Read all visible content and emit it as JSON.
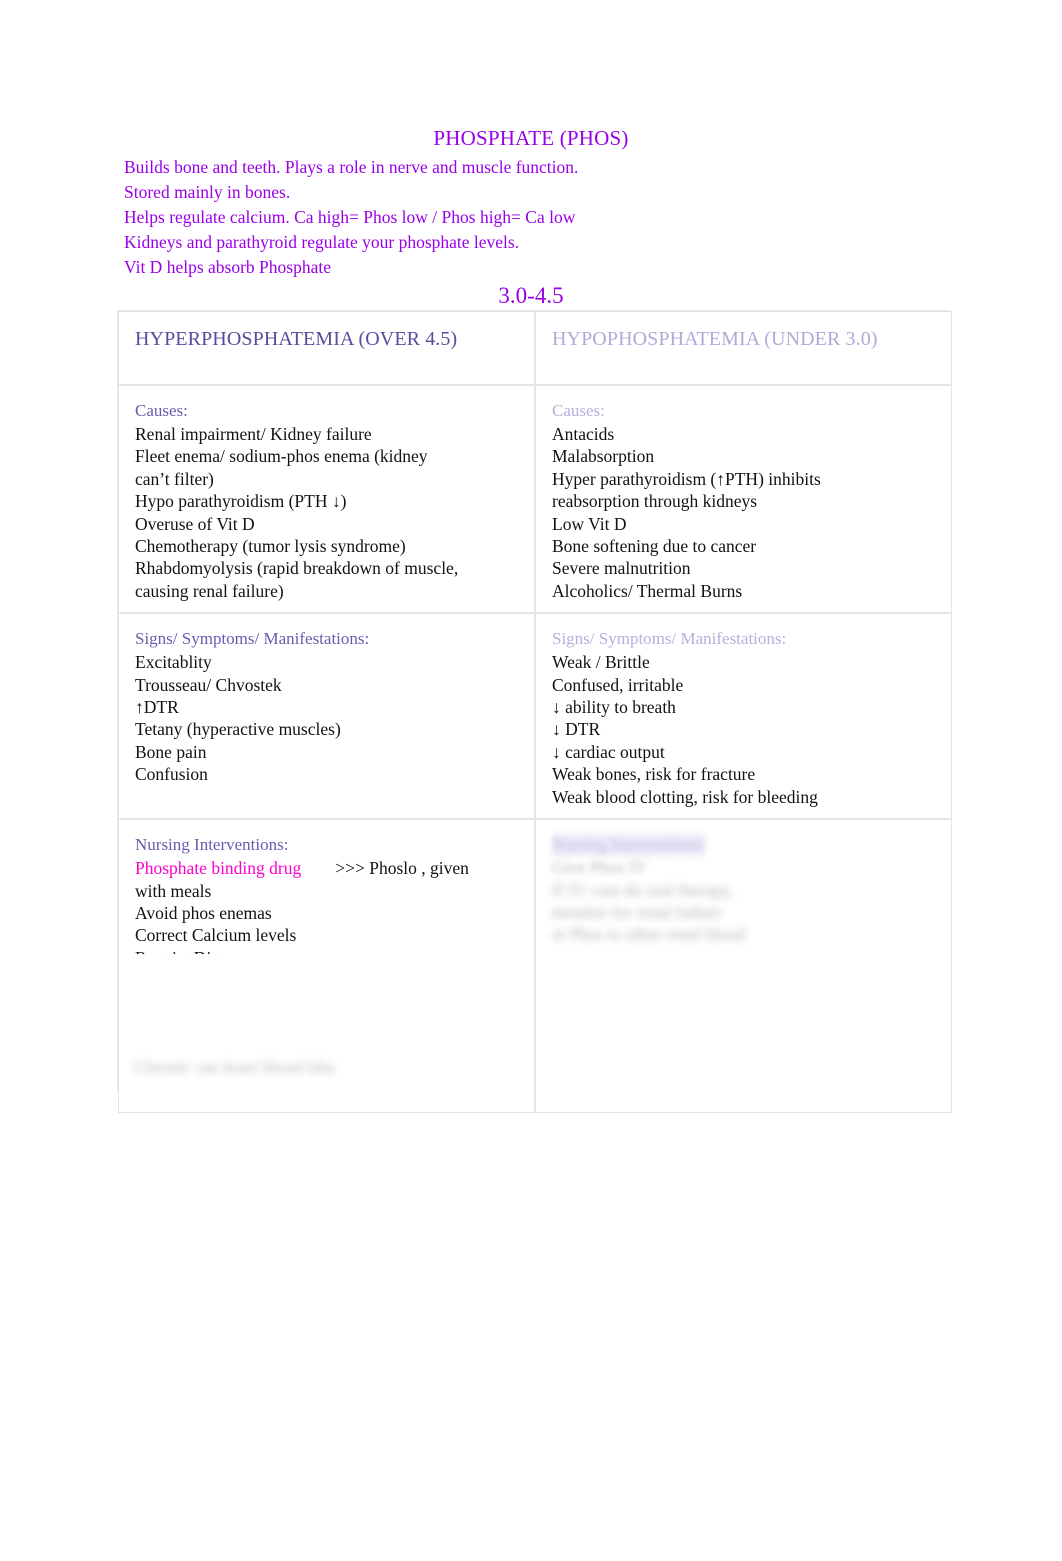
{
  "document": {
    "title": "PHOSPHATE (PHOS)",
    "intro_lines": [
      "Builds bone and teeth. Plays a role in nerve and muscle function.",
      "Stored mainly in bones.",
      "Helps regulate calcium. Ca high= Phos low / Phos high= Ca low",
      "Kidneys and parathyroid regulate your phosphate levels.",
      "Vit D helps absorb Phosphate"
    ],
    "normal_range": "3.0-4.5",
    "colors": {
      "heading_purple": "#9a00e8",
      "hyper_header": "#5a4a9e",
      "hypo_header": "#b3a9d9",
      "section_label_left": "#6a5bb0",
      "section_label_right": "#b7aedd",
      "drug_highlight": "#ff00cc",
      "body_text": "#121212",
      "table_border": "#e4e4e4"
    }
  },
  "table": {
    "headers": {
      "left": "HYPERPHOSPHATEMIA (OVER 4.5)",
      "right": "HYPOPHOSPHATEMIA (UNDER 3.0)"
    },
    "causes": {
      "label_left": "Causes:",
      "label_right": "Causes:",
      "left_items": [
        "Renal impairment/ Kidney failure",
        "Fleet enema/ sodium-phos enema (kidney",
        "can’t filter)",
        "Hypo parathyroidism (PTH ↓)",
        "Overuse of Vit D",
        "Chemotherapy (tumor lysis syndrome)",
        "Rhabdomyolysis (rapid breakdown of muscle,",
        "causing renal failure)"
      ],
      "right_items": [
        "Antacids",
        "Malabsorption",
        "Hyper  parathyroidism (↑PTH) inhibits",
        "reabsorption through kidneys",
        "Low Vit D",
        "Bone softening due to cancer",
        "Severe malnutrition",
        "Alcoholics/ Thermal Burns"
      ]
    },
    "signs": {
      "label_left": "Signs/ Symptoms/ Manifestations:",
      "label_right": "Signs/ Symptoms/ Manifestations:",
      "left_items": [
        "Excitablity",
        "Trousseau/ Chvostek",
        "↑DTR",
        "Tetany (hyperactive muscles)",
        "Bone pain",
        "Confusion"
      ],
      "right_items": [
        "Weak / Brittle",
        "Confused, irritable",
        "↓ ability to breath",
        "↓ DTR",
        "↓ cardiac output",
        "Weak bones, risk for fracture",
        "Weak blood clotting, risk for bleeding"
      ]
    },
    "interventions": {
      "label_left": "Nursing Interventions:",
      "drug_highlight": "Phosphate binding drug",
      "drug_rest": ">>> Phoslo  , given",
      "left_items": [
        "with meals",
        "Avoid phos enemas",
        "Correct Calcium levels"
      ],
      "clipped_line": "Restrict Diet",
      "redacted_label_right": "Nursing Interventions:",
      "redacted_right_lines": [
        "Give Phos IV",
        "If IV cant do oral therapy,",
        "monitor for renal failure",
        "at Phos  to other renal blood"
      ]
    }
  },
  "footer": {
    "redacted_note": "Chronic  can heart blood labs"
  }
}
